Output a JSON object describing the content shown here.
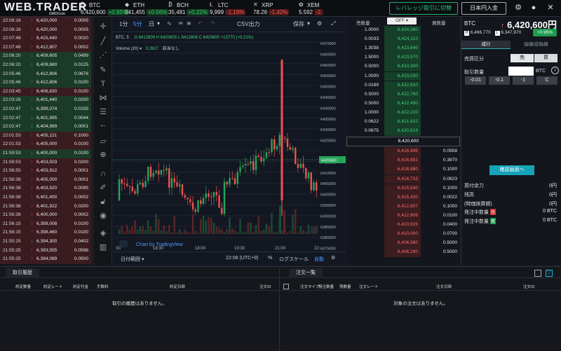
{
  "app": {
    "logo": "WEB.TRADER",
    "logo_sub": "GMOCoin"
  },
  "tickers": [
    {
      "sym": "BTC",
      "icon": "₿",
      "price": "6,420,600",
      "change": "+0.95%",
      "dir": "up"
    },
    {
      "sym": "ETH",
      "icon": "◆",
      "price": "341,455",
      "change": "+0.56%",
      "dir": "up"
    },
    {
      "sym": "BCH",
      "icon": "₿",
      "price": "35,481",
      "change": "+0.22%",
      "dir": "up"
    },
    {
      "sym": "LTC",
      "icon": "Ł",
      "price": "9,999",
      "change": "-1.19%",
      "dir": "dn"
    },
    {
      "sym": "XRP",
      "icon": "✕",
      "price": "78.26",
      "change": "-1.42%",
      "dir": "dn"
    },
    {
      "sym": "XEM",
      "icon": "✿",
      "price": "5.592",
      "change": "-2.",
      "dir": "dn"
    }
  ],
  "header": {
    "leverage_btn": "レバレッジ取引に切替",
    "deposit_btn": "日本円入金"
  },
  "history": [
    {
      "time": "22:08:16",
      "price": "6,420,000",
      "dir": "u",
      "qty": "0.0005",
      "tone": "r"
    },
    {
      "time": "22:08:16",
      "price": "6,420,000",
      "dir": "u",
      "qty": "0.0005",
      "tone": "r"
    },
    {
      "time": "22:07:48",
      "price": "6,415,440",
      "dir": "u",
      "qty": "0.0020",
      "tone": "r"
    },
    {
      "time": "22:07:48",
      "price": "6,412,807",
      "dir": "u",
      "qty": "0.0002",
      "tone": "r"
    },
    {
      "time": "22:06:20",
      "price": "6,409,605",
      "dir": "d",
      "qty": "0.0499",
      "tone": "g"
    },
    {
      "time": "22:06:20",
      "price": "6,409,680",
      "dir": "d",
      "qty": "0.0125",
      "tone": "g"
    },
    {
      "time": "22:05:46",
      "price": "6,412,806",
      "dir": "",
      "qty": "0.0676",
      "tone": "g"
    },
    {
      "time": "22:05:46",
      "price": "6,412,806",
      "dir": "u",
      "qty": "0.0100",
      "tone": "g"
    },
    {
      "time": "22:03:45",
      "price": "6,406,830",
      "dir": "u",
      "qty": "0.0100",
      "tone": "r"
    },
    {
      "time": "22:03:26",
      "price": "6,401,440",
      "dir": "u",
      "qty": "0.0200",
      "tone": "g"
    },
    {
      "time": "22:02:47",
      "price": "6,399,074",
      "dir": "d",
      "qty": "0.0155",
      "tone": "g"
    },
    {
      "time": "22:02:47",
      "price": "6,401,995",
      "dir": "d",
      "qty": "0.0044",
      "tone": "g"
    },
    {
      "time": "22:02:47",
      "price": "6,404,999",
      "dir": "d",
      "qty": "0.0001",
      "tone": "g"
    },
    {
      "time": "22:01:53",
      "price": "6,405,121",
      "dir": "u",
      "qty": "0.1000",
      "tone": "r"
    },
    {
      "time": "22:01:53",
      "price": "6,405,000",
      "dir": "u",
      "qty": "0.0100",
      "tone": "r"
    },
    {
      "time": "21:59:53",
      "price": "6,400,000",
      "dir": "d",
      "qty": "0.0100",
      "tone": "g"
    },
    {
      "time": "21:59:53",
      "price": "6,403,503",
      "dir": "u",
      "qty": "0.0200",
      "tone": "r"
    },
    {
      "time": "21:58:55",
      "price": "6,403,912",
      "dir": "u",
      "qty": "0.0001",
      "tone": "r"
    },
    {
      "time": "21:56:38",
      "price": "6,405,000",
      "dir": "u",
      "qty": "0.0001",
      "tone": "r"
    },
    {
      "time": "21:56:38",
      "price": "6,403,920",
      "dir": "u",
      "qty": "0.0095",
      "tone": "r"
    },
    {
      "time": "21:56:38",
      "price": "6,401,400",
      "dir": "u",
      "qty": "0.0002",
      "tone": "r"
    },
    {
      "time": "21:56:38",
      "price": "6,401,922",
      "dir": "u",
      "qty": "0.0200",
      "tone": "r"
    },
    {
      "time": "21:56:38",
      "price": "6,400,000",
      "dir": "u",
      "qty": "0.0002",
      "tone": "r"
    },
    {
      "time": "21:56:15",
      "price": "6,399,008",
      "dir": "u",
      "qty": "0.0100",
      "tone": "r"
    },
    {
      "time": "21:56:15",
      "price": "6,398,460",
      "dir": "u",
      "qty": "0.0100",
      "tone": "r"
    },
    {
      "time": "21:55:25",
      "price": "6,394,300",
      "dir": "d",
      "qty": "0.0402",
      "tone": "r"
    },
    {
      "time": "21:55:25",
      "price": "6,393,555",
      "dir": "u",
      "qty": "0.0598",
      "tone": "r"
    },
    {
      "time": "21:55:25",
      "price": "6,394,089",
      "dir": "u",
      "qty": "0.0500",
      "tone": "r"
    }
  ],
  "chart_toolbar": {
    "tf1": "1分",
    "tf5": "5分",
    "tfd": "日",
    "csv": "CSV出力",
    "save": "保存"
  },
  "chart_legend": {
    "symbol": "BTC, 5",
    "o": "6412806",
    "h": "6420605",
    "l": "6412806",
    "c": "6420600",
    "chg": "+13770 (+0.21%)",
    "volume": "Volume (20)",
    "vol_val": "0.2827",
    "vol_note": "該当なし"
  },
  "chart_data": {
    "type": "candlestick",
    "ylim": [
      6370000,
      6470000
    ],
    "yticks": [
      "6470000",
      "6465000",
      "6460000",
      "6455000",
      "6450000",
      "6445000",
      "6440000",
      "6435000",
      "6430000",
      "6425000",
      "6415000",
      "6410000",
      "6405000",
      "6400000",
      "6395000",
      "6390000",
      "6385000",
      "6380000",
      "6375000"
    ],
    "xticks": [
      ":00",
      "18:30",
      "18:00",
      "19:30",
      "21:00",
      "22:"
    ],
    "last_price": "6420600",
    "watermark": "Chart by TradingView"
  },
  "chart_bottom": {
    "range": "日付範囲",
    "time": "22:08 (UTC+9)",
    "pct": "%",
    "log": "ログスケール",
    "auto": "自動"
  },
  "book": {
    "head_sell": "売数量",
    "head_toggle": "OFF",
    "head_buy": "買数量",
    "asks": [
      {
        "sell": "1.0000",
        "price": "6,424,380"
      },
      {
        "sell": "0.0033",
        "price": "6,424,110"
      },
      {
        "sell": "1.3038",
        "price": "6,423,840"
      },
      {
        "sell": "1.5000",
        "price": "6,423,570"
      },
      {
        "sell": "0.5000",
        "price": "6,423,300"
      },
      {
        "sell": "1.0000",
        "price": "6,423,030"
      },
      {
        "sell": "0.0189",
        "price": "6,422,910"
      },
      {
        "sell": "0.5000",
        "price": "6,422,760"
      },
      {
        "sell": "0.5000",
        "price": "6,422,490"
      },
      {
        "sell": "1.0000",
        "price": "6,422,220"
      },
      {
        "sell": "0.0622",
        "price": "6,421,632"
      },
      {
        "sell": "0.0675",
        "price": "6,420,619"
      }
    ],
    "mid": "6,420,600",
    "bids": [
      {
        "price": "6,416,945",
        "buy": "0.0958"
      },
      {
        "price": "6,416,881",
        "buy": "0.3870"
      },
      {
        "price": "6,416,880",
        "buy": "0.1000"
      },
      {
        "price": "6,416,733",
        "buy": "0.0623"
      },
      {
        "price": "6,415,540",
        "buy": "0.1000"
      },
      {
        "price": "6,415,430",
        "buy": "0.0022"
      },
      {
        "price": "6,412,807",
        "buy": "0.1000"
      },
      {
        "price": "6,412,806",
        "buy": "0.0100"
      },
      {
        "price": "6,410,925",
        "buy": "0.0400"
      },
      {
        "price": "6,410,000",
        "buy": "0.0700"
      },
      {
        "price": "6,406,560",
        "buy": "0.5000"
      },
      {
        "price": "6,406,290",
        "buy": "0.5000"
      }
    ]
  },
  "right": {
    "sym": "BTC",
    "price": "6,420,600円",
    "high": "6,466,770",
    "low": "6,347,970",
    "change": "+0.95%",
    "tab1": "成行",
    "tab2": "指値/逆指値",
    "side_label": "売買区分",
    "sell": "売",
    "buy": "買",
    "qty_label": "取引数量",
    "qty_unit": "BTC",
    "q1": "-0.01",
    "q2": "-0.1",
    "q3": "-1",
    "q4": "C",
    "confirm": "確認画面へ",
    "rows": [
      {
        "label": "買付余力",
        "val": "0円"
      },
      {
        "label": "残高",
        "val": "0円"
      },
      {
        "label": "(時価換算額)",
        "val": "0円"
      },
      {
        "label": "発注中数量",
        "tag": "売",
        "val": "0 BTC"
      },
      {
        "label": "発注中数量",
        "tag": "買",
        "val": "0 BTC"
      }
    ]
  },
  "bottom": {
    "left_title": "取引履歴",
    "left_cols": [
      "約定数量",
      "約定レート",
      "約定代金",
      "手数料",
      "約定日時",
      "注文ID"
    ],
    "left_empty": "取引の履歴はありません。",
    "right_title": "注文一覧",
    "right_cols": [
      "注文タイプ",
      "発注数量",
      "残数量",
      "注文レート",
      "注文日時",
      "注文ID"
    ],
    "right_empty": "対象の注文はありません。"
  },
  "colors": {
    "up": "#2fcd6b",
    "down": "#ff5b5b",
    "accent": "#16a3b8"
  }
}
